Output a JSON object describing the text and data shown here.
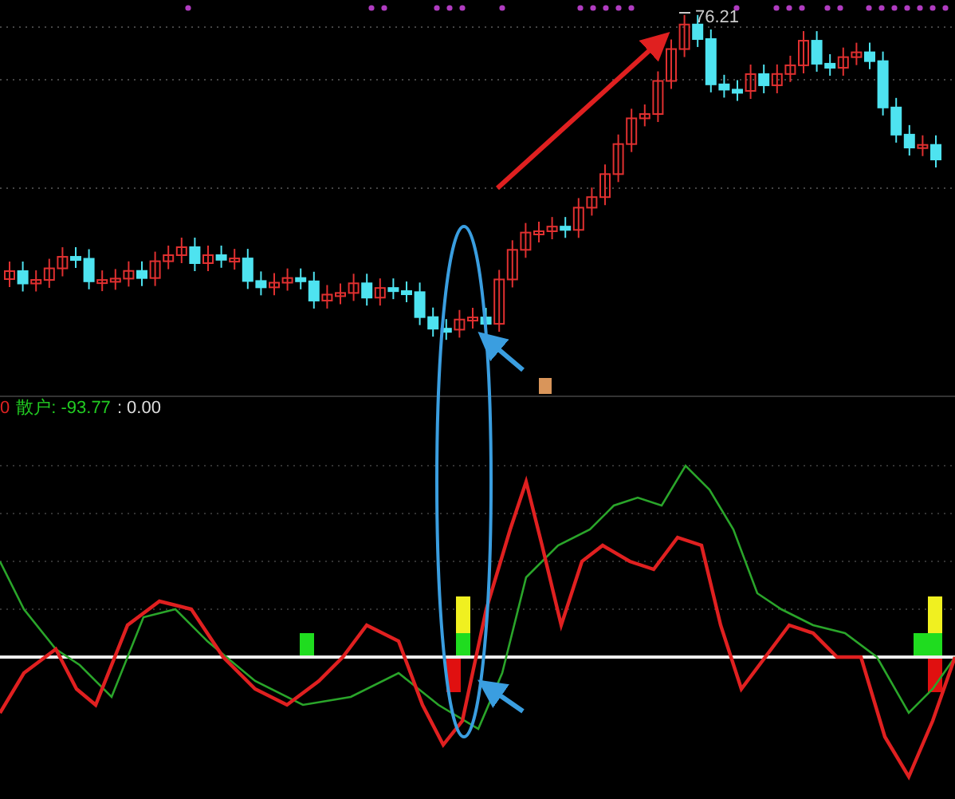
{
  "price_chart": {
    "high_label": "76.21"
  },
  "indicator": {
    "prefix": "0",
    "legend_label": "散户: -93.77",
    "legend_value": ": 0.00"
  }
}
